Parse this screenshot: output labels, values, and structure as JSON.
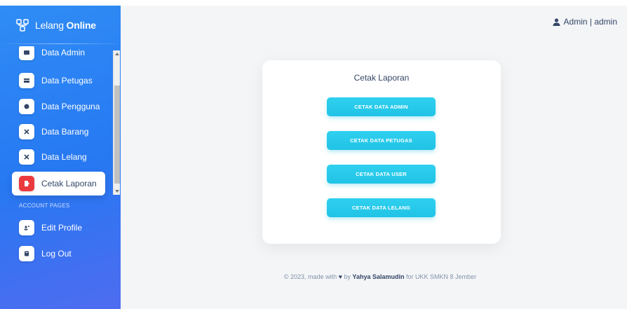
{
  "brand": {
    "name_thin": "Lelang ",
    "name_bold": "Online"
  },
  "sidebar": {
    "items": [
      {
        "label": "Data Admin"
      },
      {
        "label": "Data Petugas"
      },
      {
        "label": "Data Pengguna"
      },
      {
        "label": "Data Barang"
      },
      {
        "label": "Data Lelang"
      },
      {
        "label": "Cetak Laporan",
        "active": true
      }
    ],
    "section_label": "ACCOUNT PAGES",
    "account_items": [
      {
        "label": "Edit Profile"
      },
      {
        "label": "Log Out"
      }
    ]
  },
  "header": {
    "user_label": "Admin | admin"
  },
  "card": {
    "title": "Cetak Laporan",
    "buttons": [
      {
        "label": "CETAK DATA ADMIN"
      },
      {
        "label": "CETAK DATA PETUGAS"
      },
      {
        "label": "CETAK DATA USER"
      },
      {
        "label": "CETAK DATA LELANG"
      }
    ]
  },
  "footer": {
    "prefix": "© 2023, made with",
    "by": "by",
    "author": "Yahya Salamudin",
    "suffix": "for UKK SMKN 8 Jember"
  },
  "colors": {
    "sidebar": "#2778f2",
    "button": "#21c3e6",
    "active_icon": "#ea3a3f",
    "text": "#344767"
  }
}
